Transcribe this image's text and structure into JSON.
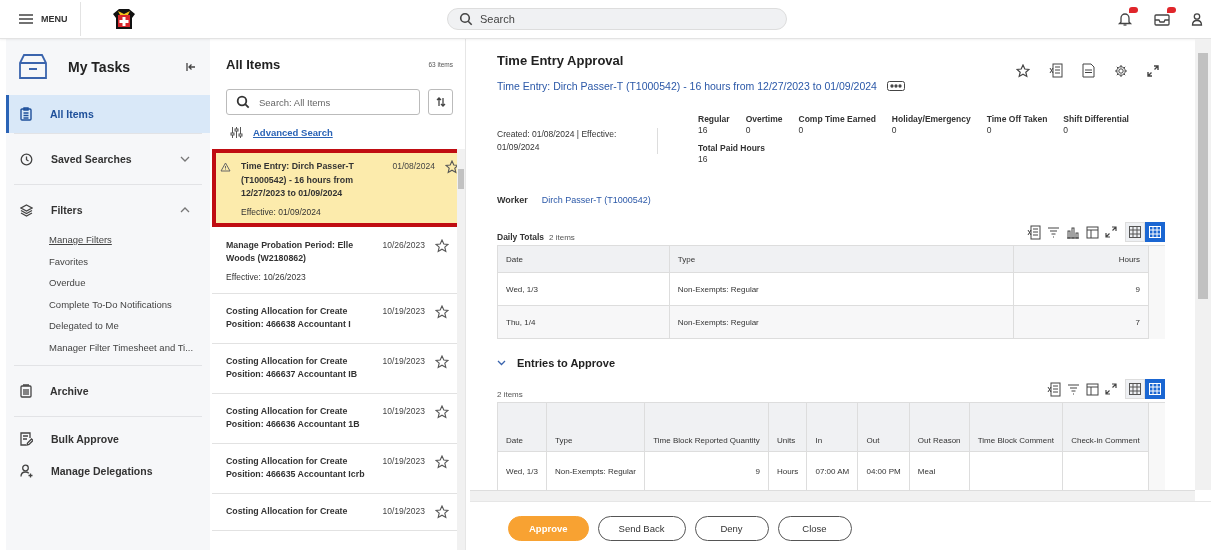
{
  "topbar": {
    "menu_label": "MENU",
    "search_placeholder": "Search"
  },
  "sidebar": {
    "title": "My Tasks",
    "sections": [
      {
        "items": [
          {
            "label": "All Items",
            "kind": "link",
            "selected": true
          }
        ]
      },
      {
        "items": [
          {
            "label": "Saved Searches",
            "kind": "group",
            "selected": false,
            "expanded": false
          }
        ]
      },
      {
        "items": [
          {
            "label": "Filters",
            "kind": "group",
            "selected": false,
            "expanded": true,
            "children": [
              {
                "label": "Manage Filters",
                "selected": true
              },
              {
                "label": "Favorites",
                "selected": false
              },
              {
                "label": "Overdue",
                "selected": false
              },
              {
                "label": "Complete To-Do Notifications",
                "selected": false
              },
              {
                "label": "Delegated to Me",
                "selected": false
              },
              {
                "label": "Manager Filter Timesheet and Ti...",
                "selected": false
              }
            ]
          }
        ]
      },
      {
        "items": [
          {
            "label": "Archive",
            "kind": "link",
            "selected": false
          }
        ]
      },
      {
        "items": [
          {
            "label": "Bulk Approve",
            "kind": "link",
            "selected": false
          },
          {
            "label": "Manage Delegations",
            "kind": "link",
            "selected": false
          }
        ]
      }
    ]
  },
  "all_items": {
    "title": "All Items",
    "count": "63 items",
    "search_placeholder": "Search: All Items",
    "advanced_search": "Advanced Search",
    "items": [
      {
        "title": "Time Entry: Dirch Passer-T (T1000542) - 16 hours from 12/27/2023 to 01/09/2024",
        "date": "01/08/2024",
        "effective": "Effective: 01/09/2024",
        "selected": true,
        "warning": true
      },
      {
        "title": "Manage Probation Period: Elle Woods (W2180862)",
        "date": "10/26/2023",
        "effective": "Effective: 10/26/2023",
        "selected": false,
        "warning": false
      },
      {
        "title": "Costing Allocation for Create Position: 466638 Accountant I",
        "date": "10/19/2023",
        "selected": false,
        "warning": false
      },
      {
        "title": "Costing Allocation for Create Position: 466637 Accountant IB",
        "date": "10/19/2023",
        "selected": false,
        "warning": false
      },
      {
        "title": "Costing Allocation for Create Position: 466636 Accountant 1B",
        "date": "10/19/2023",
        "selected": false,
        "warning": false
      },
      {
        "title": "Costing Allocation for Create Position: 466635 Accountant Icrb",
        "date": "10/19/2023",
        "selected": false,
        "warning": false
      },
      {
        "title": "Costing Allocation for Create",
        "date": "10/19/2023",
        "selected": false,
        "warning": false
      }
    ]
  },
  "detail": {
    "title": "Time Entry Approval",
    "subtitle": "Time Entry: Dirch Passer-T (T1000542) - 16 hours from 12/27/2023 to 01/09/2024",
    "created": "Created: 01/08/2024 | Effective: 01/09/2024",
    "summary": [
      {
        "label": "Regular",
        "value": "16"
      },
      {
        "label": "Overtime",
        "value": "0"
      },
      {
        "label": "Comp Time Earned",
        "value": "0"
      },
      {
        "label": "Holiday/Emergency",
        "value": "0"
      },
      {
        "label": "Time Off Taken",
        "value": "0"
      },
      {
        "label": "Shift Differential",
        "value": "0"
      },
      {
        "label": "Total Paid Hours",
        "value": "16"
      }
    ],
    "worker": {
      "label": "Worker",
      "value": "Dirch Passer-T (T1000542)"
    },
    "daily_totals": {
      "title": "Daily Totals",
      "count": "2 items",
      "view_toggle": [
        {
          "selected": false
        },
        {
          "selected": true
        }
      ],
      "columns": [
        "Date",
        "Type",
        "Hours"
      ],
      "rows": [
        [
          "Wed, 1/3",
          "Non-Exempts: Regular",
          "9"
        ],
        [
          "Thu, 1/4",
          "Non-Exempts: Regular",
          "7"
        ]
      ]
    },
    "entries": {
      "title": "Entries to Approve",
      "expanded": true,
      "count": "2 items",
      "view_toggle": [
        {
          "selected": false
        },
        {
          "selected": true
        }
      ],
      "columns": [
        "Date",
        "Type",
        "Time Block Reported Quantity",
        "Units",
        "In",
        "Out",
        "Out Reason",
        "Time Block Comment",
        "Check-in Comment"
      ],
      "rows": [
        [
          "Wed, 1/3",
          "Non-Exempts: Regular",
          "9",
          "Hours",
          "07:00 AM",
          "04:00 PM",
          "Meal"
        ]
      ]
    }
  },
  "actions": [
    {
      "label": "Approve",
      "kind": "primary"
    },
    {
      "label": "Send Back",
      "kind": "secondary"
    },
    {
      "label": "Deny",
      "kind": "secondary"
    },
    {
      "label": "Close",
      "kind": "secondary"
    }
  ]
}
